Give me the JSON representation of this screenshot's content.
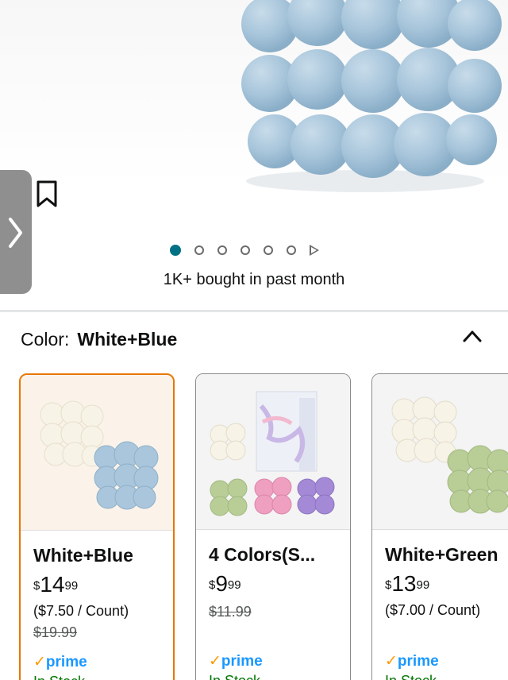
{
  "hero": {
    "bought_text": "1K+ bought in past month",
    "image_icon": "bubble-candle-blue-image",
    "dots": {
      "count": 6,
      "active_index": 0,
      "has_video": true
    }
  },
  "variation": {
    "label": "Color:",
    "selected": "White+Blue"
  },
  "options": [
    {
      "name": "White+Blue",
      "currency": "$",
      "price_whole": "14",
      "price_cents": "99",
      "unit": "($7.50 / Count)",
      "was": "$19.99",
      "prime": "prime",
      "stock": "In Stock",
      "selected": true
    },
    {
      "name": "4 Colors(S...",
      "currency": "$",
      "price_whole": "9",
      "price_cents": "99",
      "unit": "",
      "was": "$11.99",
      "prime": "prime",
      "stock": "In Stock",
      "selected": false
    },
    {
      "name": "White+Green",
      "currency": "$",
      "price_whole": "13",
      "price_cents": "99",
      "unit": "($7.00 / Count)",
      "was": "",
      "prime": "prime",
      "stock": "In Stock",
      "selected": false
    }
  ],
  "colors": {
    "accent_teal": "#007185",
    "selected_border": "#e77600",
    "prime_blue": "#1a98ff",
    "prime_check": "#ff9900",
    "candle_blue": "#a9c6dc",
    "candle_white": "#f7f3e6",
    "candle_green": "#b9cd97",
    "candle_pink": "#ef9fc0",
    "candle_purple": "#a48ad6"
  }
}
